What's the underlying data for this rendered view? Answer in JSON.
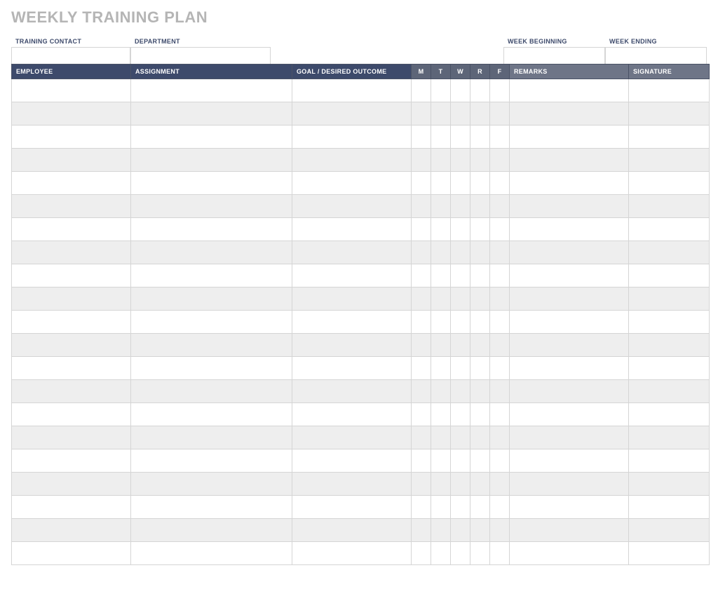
{
  "title": "WEEKLY TRAINING PLAN",
  "meta": {
    "training_contact_label": "TRAINING CONTACT",
    "department_label": "DEPARTMENT",
    "week_beginning_label": "WEEK BEGINNING",
    "week_ending_label": "WEEK ENDING",
    "training_contact_value": "",
    "department_value": "",
    "week_beginning_value": "",
    "week_ending_value": ""
  },
  "columns": {
    "employee": "EMPLOYEE",
    "assignment": "ASSIGNMENT",
    "goal": "GOAL / DESIRED OUTCOME",
    "m": "M",
    "t": "T",
    "w": "W",
    "r": "R",
    "f": "F",
    "remarks": "REMARKS",
    "signature": "SIGNATURE"
  },
  "row_count": 21
}
